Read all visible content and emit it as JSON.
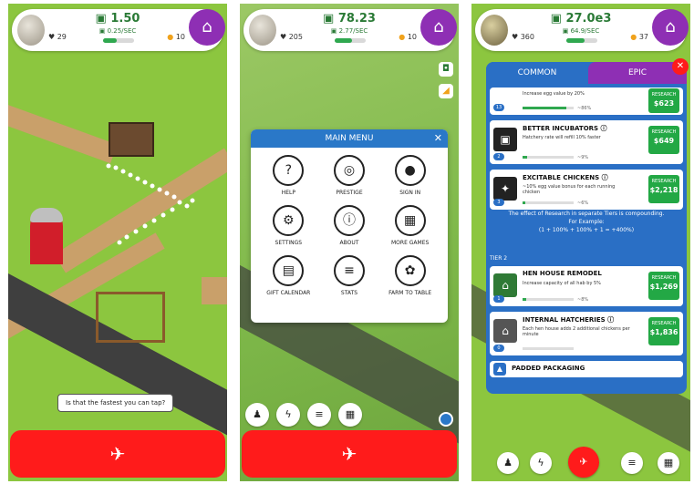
{
  "panel1": {
    "header": {
      "hearts": "29",
      "cash": "1.50",
      "rate": "0.25/SEC",
      "gems": "10",
      "progress": 0.45
    },
    "speech": "Is that the fastest you can tap?",
    "hatch_icon": "chicken-icon"
  },
  "panel2": {
    "header": {
      "hearts": "205",
      "cash": "78.23",
      "rate": "2.77/SEC",
      "gems": "10",
      "progress": 0.55
    },
    "menu": {
      "title": "MAIN MENU",
      "items": [
        {
          "label": "HELP",
          "icon": "?"
        },
        {
          "label": "PRESTIGE",
          "icon": "◎"
        },
        {
          "label": "SIGN IN",
          "icon": "●"
        },
        {
          "label": "SETTINGS",
          "icon": "⚙"
        },
        {
          "label": "ABOUT",
          "icon": "ⓘ"
        },
        {
          "label": "MORE GAMES",
          "icon": "▦"
        },
        {
          "label": "GIFT CALENDAR",
          "icon": "▤"
        },
        {
          "label": "STATS",
          "icon": "≡"
        },
        {
          "label": "FARM TO TABLE",
          "icon": "✿"
        }
      ]
    }
  },
  "panel3": {
    "header": {
      "hearts": "360",
      "cash": "27.0e3",
      "rate": "64.9/SEC",
      "gems": "37",
      "progress": 0.6
    },
    "tabs": {
      "common": "COMMON",
      "epic": "EPIC"
    },
    "cards": [
      {
        "title": "",
        "desc": "Increase egg value by 20%",
        "pct": "~86%",
        "button": "RESEARCH",
        "cost": "$623",
        "level": "13",
        "progress": 0.86
      },
      {
        "title": "BETTER INCUBATORS",
        "desc": "Hatchery rate will refill 10% faster",
        "pct": "~9%",
        "button": "RESEARCH",
        "cost": "$649",
        "level": "2",
        "progress": 0.09
      },
      {
        "title": "EXCITABLE CHICKENS",
        "desc": "~10% egg value bonus for each running chicken",
        "pct": "~6%",
        "button": "RESEARCH",
        "cost": "$2,218",
        "level": "3",
        "progress": 0.06
      },
      {
        "title": "HEN HOUSE REMODEL",
        "desc": "Increase capacity of all hab by 5%",
        "pct": "~8%",
        "button": "RESEARCH",
        "cost": "$1,269",
        "level": "1",
        "progress": 0.08
      },
      {
        "title": "INTERNAL HATCHERIES",
        "desc": "Each hen house adds 2 additional chickens per minute",
        "pct": "",
        "button": "RESEARCH",
        "cost": "$1,836",
        "level": "0",
        "progress": 0.0
      },
      {
        "title": "PADDED PACKAGING",
        "desc": "",
        "pct": "",
        "button": "",
        "cost": "",
        "level": "",
        "progress": 0.0
      }
    ],
    "info": [
      "The effect of Research in separate Tiers is compounding.",
      "For Example:",
      "(1 + 100% + 100% + 1 = +400%)"
    ],
    "tier_label": "TIER 2"
  }
}
